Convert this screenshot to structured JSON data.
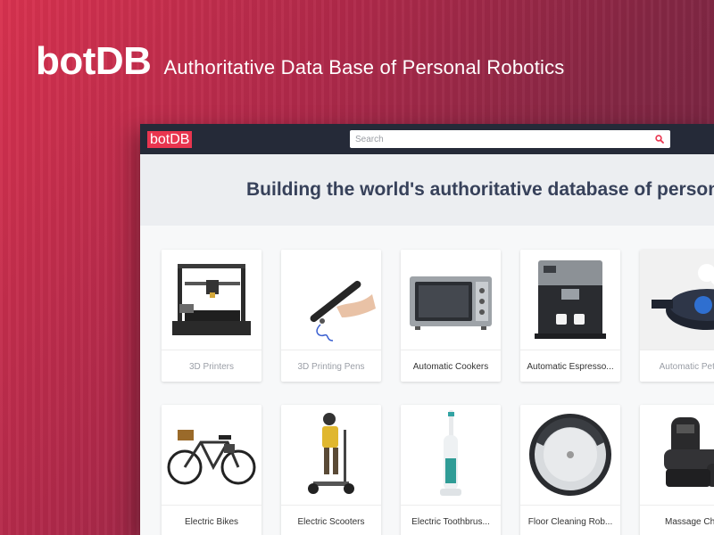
{
  "hero": {
    "logo": "botDB",
    "tagline": "Authoritative Data Base of Personal Robotics"
  },
  "app": {
    "logo": "botDB",
    "search": {
      "placeholder": "Search"
    },
    "banner_title": "Building the world's authoritative database of personal ro",
    "colors": {
      "accent": "#e9354f",
      "topbar": "#252a38",
      "heading": "#37415a"
    }
  },
  "categories": [
    {
      "label": "3D Printers",
      "icon": "3d-printer-icon",
      "muted": true
    },
    {
      "label": "3D Printing Pens",
      "icon": "3d-pen-icon",
      "muted": true
    },
    {
      "label": "Automatic Cookers",
      "icon": "oven-icon",
      "muted": false
    },
    {
      "label": "Automatic Espresso...",
      "icon": "espresso-machine-icon",
      "muted": false
    },
    {
      "label": "Automatic Pet Fe",
      "icon": "pet-feeder-icon",
      "muted": true
    },
    {
      "label": "Electric Bikes",
      "icon": "bicycle-icon",
      "muted": false
    },
    {
      "label": "Electric Scooters",
      "icon": "scooter-icon",
      "muted": false
    },
    {
      "label": "Electric Toothbrus...",
      "icon": "toothbrush-icon",
      "muted": false
    },
    {
      "label": "Floor Cleaning Rob...",
      "icon": "robot-vacuum-icon",
      "muted": false
    },
    {
      "label": "Massage Chai",
      "icon": "massage-chair-icon",
      "muted": false
    }
  ]
}
